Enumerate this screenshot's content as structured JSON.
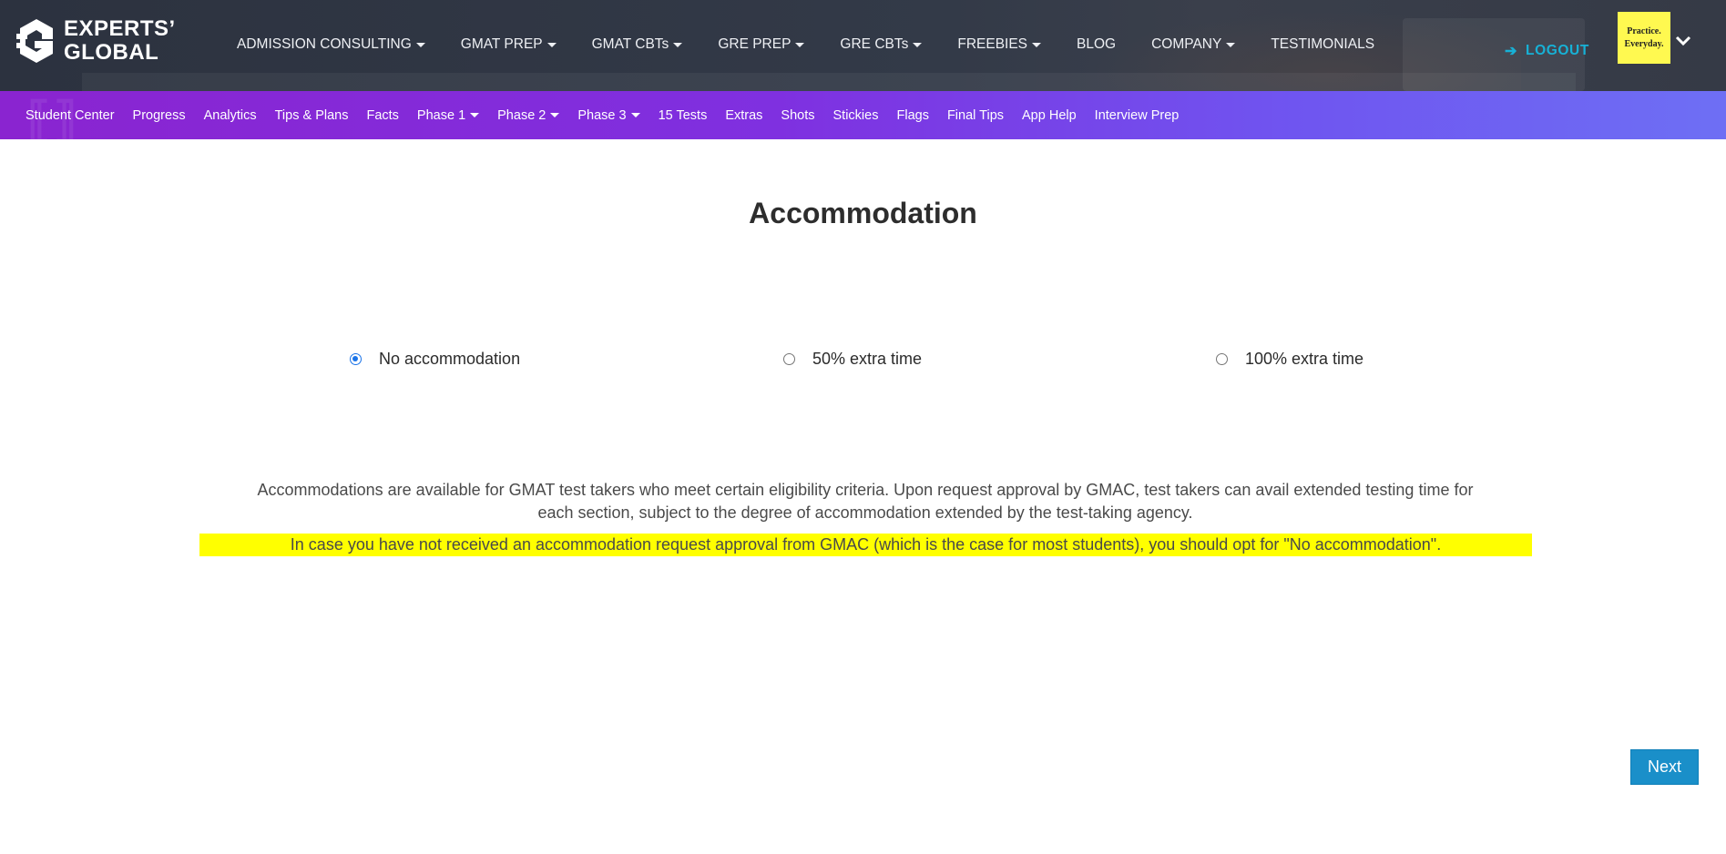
{
  "brand": {
    "line1": "EXPERTS’",
    "line2": "GLOBAL"
  },
  "main_nav": [
    {
      "label": "ADMISSION CONSULTING",
      "dropdown": true
    },
    {
      "label": "GMAT PREP",
      "dropdown": true
    },
    {
      "label": "GMAT CBTs",
      "dropdown": true
    },
    {
      "label": "GRE PREP",
      "dropdown": true
    },
    {
      "label": "GRE CBTs",
      "dropdown": true
    },
    {
      "label": "FREEBIES",
      "dropdown": true
    },
    {
      "label": "BLOG",
      "dropdown": false
    },
    {
      "label": "COMPANY",
      "dropdown": true
    },
    {
      "label": "TESTIMONIALS",
      "dropdown": false
    }
  ],
  "logout": {
    "label": "LOGOUT",
    "icon": "arrow-right-icon"
  },
  "badge": {
    "line1": "Practice.",
    "line2": "Everyday."
  },
  "sub_nav": [
    {
      "label": "Student Center",
      "dropdown": false
    },
    {
      "label": "Progress",
      "dropdown": false
    },
    {
      "label": "Analytics",
      "dropdown": false
    },
    {
      "label": "Tips & Plans",
      "dropdown": false
    },
    {
      "label": "Facts",
      "dropdown": false
    },
    {
      "label": "Phase 1",
      "dropdown": true
    },
    {
      "label": "Phase 2",
      "dropdown": true
    },
    {
      "label": "Phase 3",
      "dropdown": true
    },
    {
      "label": "15 Tests",
      "dropdown": false
    },
    {
      "label": "Extras",
      "dropdown": false
    },
    {
      "label": "Shots",
      "dropdown": false
    },
    {
      "label": "Stickies",
      "dropdown": false
    },
    {
      "label": "Flags",
      "dropdown": false
    },
    {
      "label": "Final Tips",
      "dropdown": false
    },
    {
      "label": "App Help",
      "dropdown": false
    },
    {
      "label": "Interview Prep",
      "dropdown": false
    }
  ],
  "page": {
    "title": "Accommodation",
    "options": [
      {
        "label": "No accommodation",
        "selected": true
      },
      {
        "label": "50% extra time",
        "selected": false
      },
      {
        "label": "100% extra time",
        "selected": false
      }
    ],
    "info_line1": "Accommodations are available for GMAT test takers who meet certain eligibility criteria. Upon request approval by GMAC, test takers can avail extended testing time for",
    "info_line2": "each section, subject to the degree of accommodation extended by the test-taking agency.",
    "note": "In case you have not received an accommodation request approval from GMAC (which is the case for most students), you should opt for \"No accommodation\".",
    "next_label": "Next"
  },
  "colors": {
    "header_bg": "#2c323f",
    "subnav_start": "#8a24d0",
    "subnav_end": "#6e6ff4",
    "logout": "#17b1d6",
    "badge_bg": "#fff950",
    "highlight": "#ffff00",
    "next_button": "#1a8fc9",
    "radio_selected": "#1a73e8"
  }
}
